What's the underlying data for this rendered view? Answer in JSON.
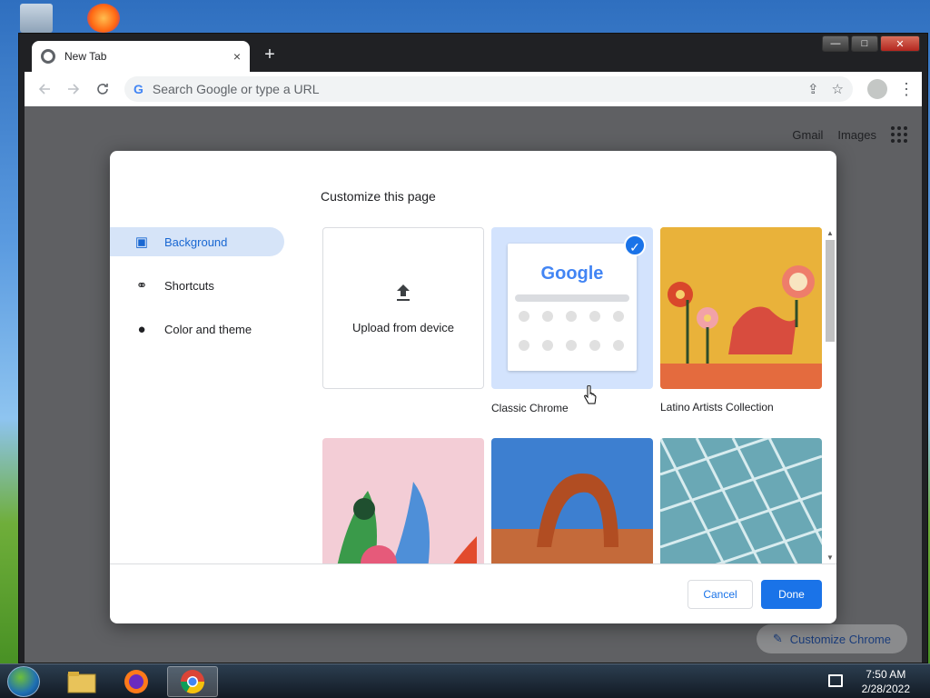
{
  "window": {
    "tab_title": "New Tab",
    "tab_close": "×",
    "new_tab": "+",
    "controls": {
      "minimize": "—",
      "maximize": "□",
      "close": "✕"
    }
  },
  "toolbar": {
    "back_icon": "arrow-left-icon",
    "forward_icon": "arrow-right-icon",
    "reload_icon": "reload-icon",
    "omnibox_g": "G",
    "omnibox_placeholder": "Search Google or type a URL",
    "menu": "⋮"
  },
  "ntp": {
    "gmail": "Gmail",
    "images": "Images",
    "customize_chrome": "Customize Chrome"
  },
  "dialog": {
    "title": "Customize this page",
    "sidebar": [
      {
        "label": "Background",
        "icon": "image-icon",
        "active": true
      },
      {
        "label": "Shortcuts",
        "icon": "link-icon",
        "active": false
      },
      {
        "label": "Color and theme",
        "icon": "palette-icon",
        "active": false
      }
    ],
    "tiles": {
      "upload_label": "Upload from device",
      "classic_label": "Classic Chrome",
      "classic_google": "Google",
      "latino_label": "Latino Artists Collection"
    },
    "buttons": {
      "cancel": "Cancel",
      "done": "Done"
    }
  },
  "taskbar": {
    "time": "7:50 AM",
    "date": "2/28/2022"
  },
  "colors": {
    "accent": "#1a73e8",
    "selected_bg": "#d3e3fd"
  }
}
